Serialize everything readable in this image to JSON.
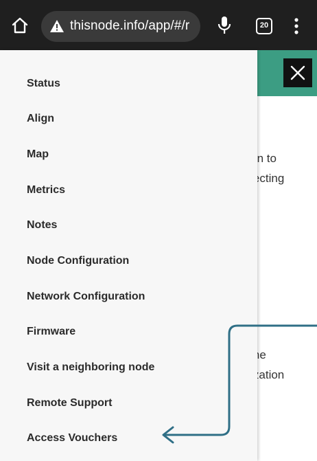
{
  "browser": {
    "url": "thisnode.info/app/#/r",
    "tab_count": "20",
    "icons": {
      "home": "home-icon",
      "security_warning": "warning-triangle-icon",
      "voice_search": "microphone-icon",
      "tabs": "tab-switcher-icon",
      "menu": "kebab-menu-icon"
    }
  },
  "page": {
    "header_color": "#3c9d83",
    "close_icon": "close-icon",
    "background_text": [
      "reen to",
      "nnecting",
      "n the",
      "orization"
    ]
  },
  "drawer": {
    "items": [
      {
        "label": "Status"
      },
      {
        "label": "Align"
      },
      {
        "label": "Map"
      },
      {
        "label": "Metrics"
      },
      {
        "label": "Notes"
      },
      {
        "label": "Node Configuration"
      },
      {
        "label": "Network Configuration"
      },
      {
        "label": "Firmware"
      },
      {
        "label": "Visit a neighboring node"
      },
      {
        "label": "Remote Support"
      },
      {
        "label": "Access Vouchers"
      }
    ]
  },
  "annotation": {
    "arrow_color": "#2f6f86",
    "icon": "arrow-pointer-icon"
  }
}
